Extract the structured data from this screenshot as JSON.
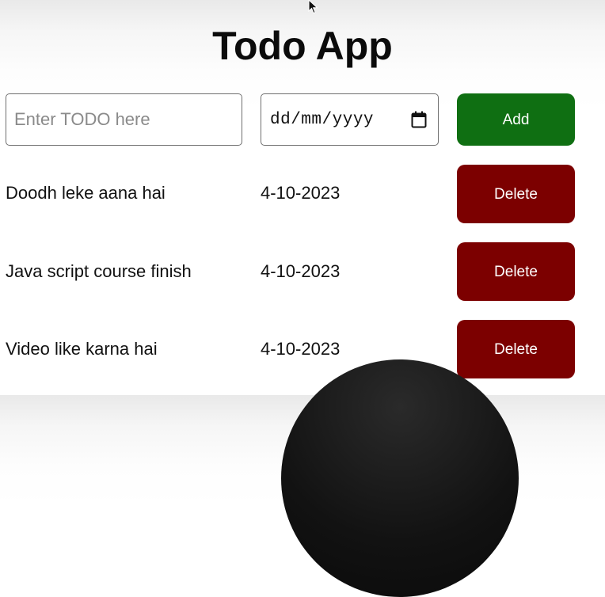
{
  "header": {
    "title": "Todo App"
  },
  "form": {
    "todo_placeholder": "Enter TODO here",
    "date_placeholder": "dd/mm/yyyy",
    "add_label": "Add"
  },
  "todos": [
    {
      "name": "Doodh leke aana hai",
      "date": "4-10-2023",
      "delete_label": "Delete"
    },
    {
      "name": "Java script course finish",
      "date": "4-10-2023",
      "delete_label": "Delete"
    },
    {
      "name": "Video like karna hai",
      "date": "4-10-2023",
      "delete_label": "Delete"
    }
  ],
  "colors": {
    "add_button": "#0f6f12",
    "delete_button": "#7c0000"
  },
  "icons": {
    "date_picker": "calendar-icon",
    "pointer": "mouse-cursor-icon"
  }
}
